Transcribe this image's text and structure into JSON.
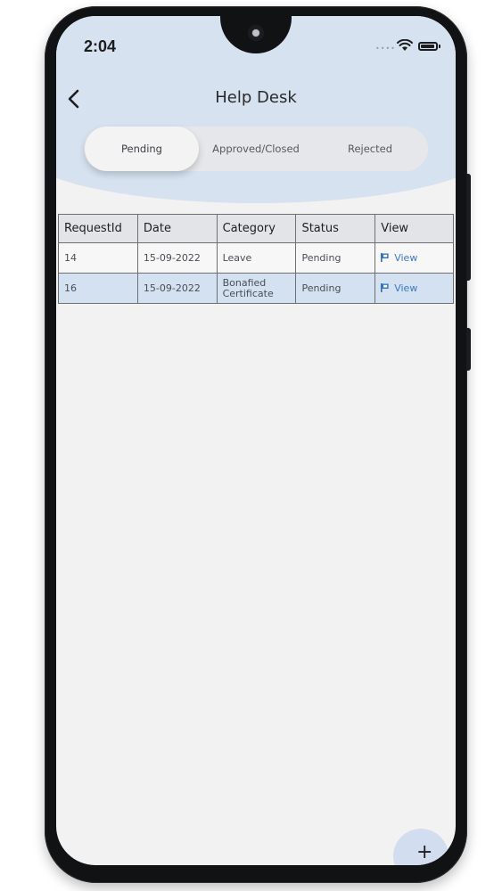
{
  "status_bar": {
    "time": "2:04",
    "icons": [
      "signal-dots-icon",
      "wifi-icon",
      "battery-icon"
    ]
  },
  "header": {
    "title": "Help Desk",
    "back_icon": "chevron-left-icon"
  },
  "tabs": [
    {
      "label": "Pending",
      "active": true
    },
    {
      "label": "Approved/Closed",
      "active": false
    },
    {
      "label": "Rejected",
      "active": false
    }
  ],
  "table": {
    "columns": [
      "RequestId",
      "Date",
      "Category",
      "Status",
      "View"
    ],
    "rows": [
      {
        "request_id": "14",
        "date": "15-09-2022",
        "category": [
          "Leave"
        ],
        "status": "Pending",
        "view": "View"
      },
      {
        "request_id": "16",
        "date": "15-09-2022",
        "category": [
          "Bonafied",
          "Certificate"
        ],
        "status": "Pending",
        "view": "View"
      }
    ]
  },
  "fab": {
    "label": "+",
    "icon": "plus-icon"
  },
  "colors": {
    "header_bg": "#d6e2f0",
    "highlight_row": "#d4e1f0",
    "link": "#3a79c8",
    "screen_bg": "#f2f2f3"
  }
}
